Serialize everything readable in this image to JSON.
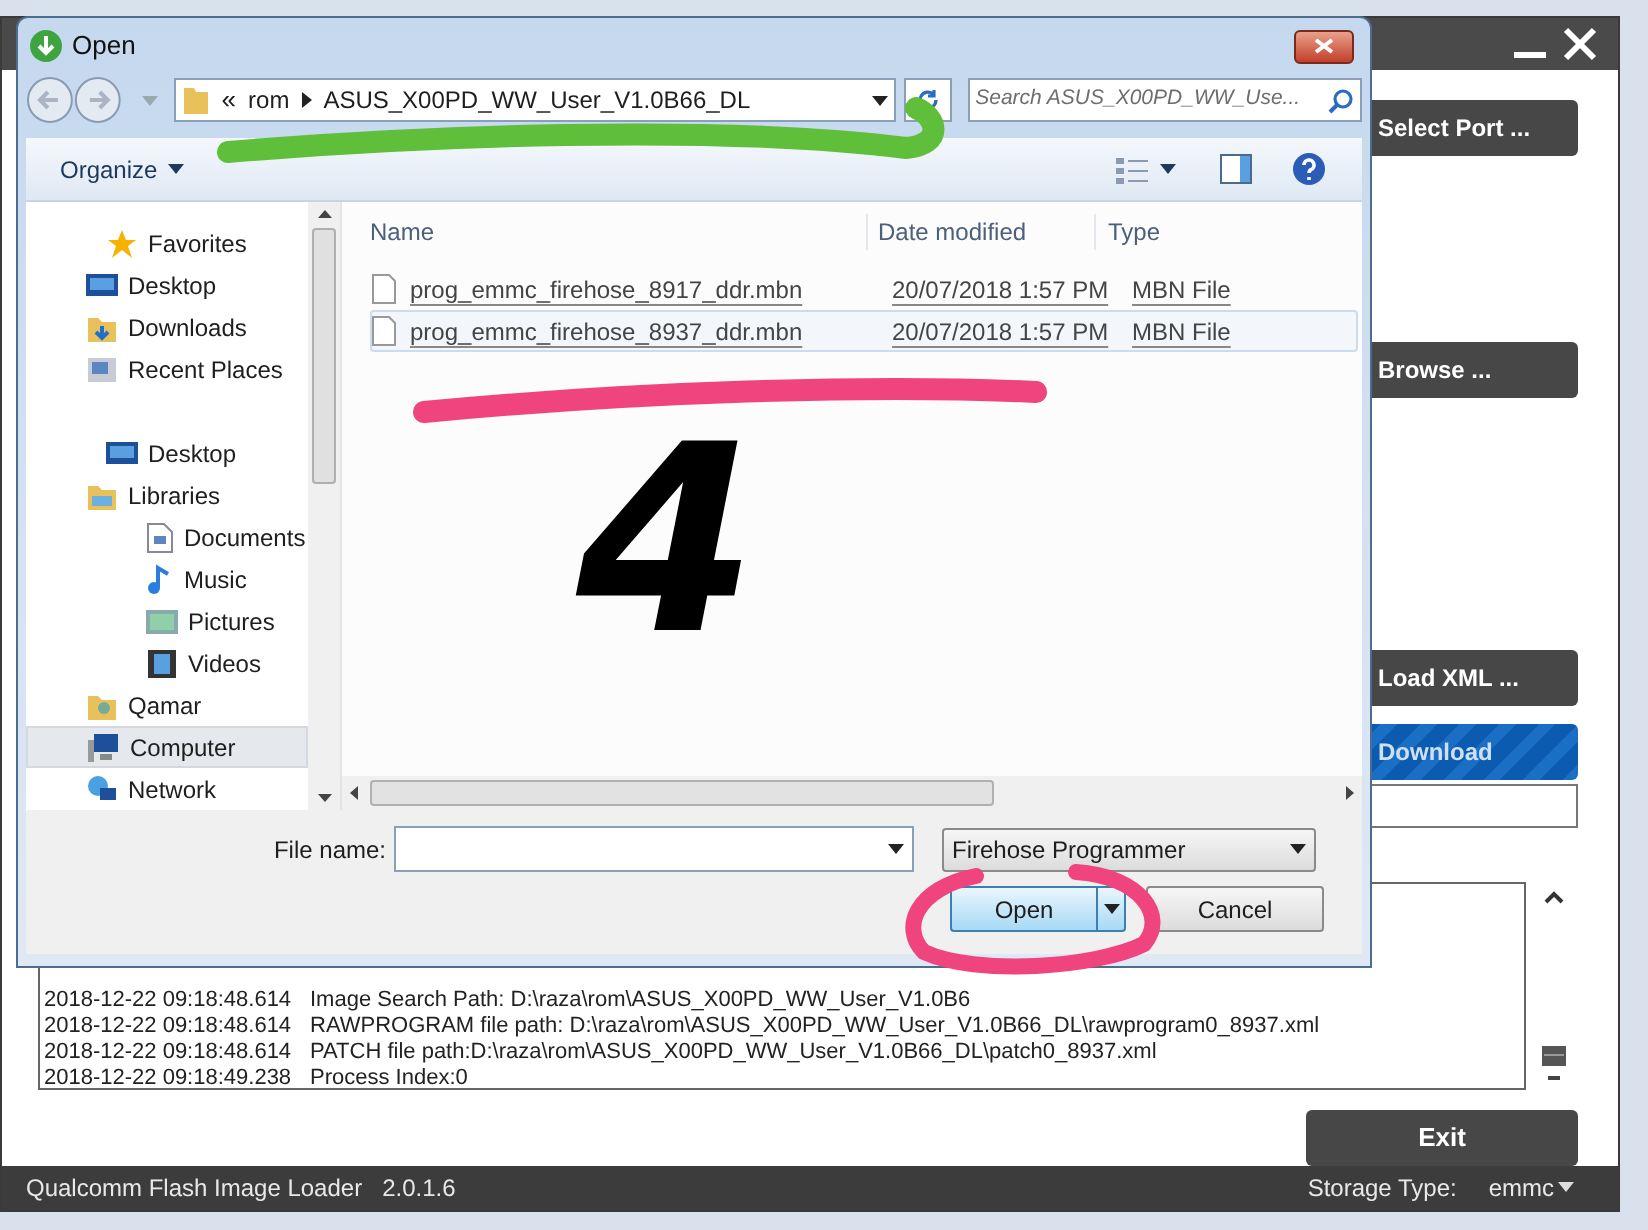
{
  "app": {
    "buttons": [
      {
        "label": "Select Port ...",
        "kind": "dark"
      },
      {
        "label": "Browse ...",
        "kind": "dark"
      },
      {
        "label": "Load XML ...",
        "kind": "dark"
      },
      {
        "label": "Download",
        "kind": "striped"
      }
    ],
    "log": [
      {
        "time": "2018-12-22 09:18:48.614",
        "message": "Image Search Path: D:\\raza\\rom\\ASUS_X00PD_WW_User_V1.0B6"
      },
      {
        "time": "2018-12-22 09:18:48.614",
        "message": "RAWPROGRAM file path: D:\\raza\\rom\\ASUS_X00PD_WW_User_V1.0B66_DL\\rawprogram0_8937.xml"
      },
      {
        "time": "2018-12-22 09:18:48.614",
        "message": "PATCH file path:D:\\raza\\rom\\ASUS_X00PD_WW_User_V1.0B66_DL\\patch0_8937.xml"
      },
      {
        "time": "2018-12-22 09:18:49.238",
        "message": "Process Index:0"
      }
    ],
    "exit_button": "Exit",
    "status_bar": {
      "product": "Qualcomm Flash Image Loader",
      "version": "2.0.1.6",
      "storage_label": "Storage Type:",
      "storage_value": "emmc"
    }
  },
  "dialog": {
    "title": "Open",
    "breadcrumb": {
      "overflow": "«",
      "segments": [
        "rom",
        "ASUS_X00PD_WW_User_V1.0B66_DL"
      ]
    },
    "search": {
      "placeholder": "Search ASUS_X00PD_WW_Use..."
    },
    "organize": "Organize",
    "nav": [
      {
        "label": "Favorites",
        "selected": false,
        "children": [
          {
            "label": "Desktop",
            "selected": false
          },
          {
            "label": "Downloads",
            "selected": false
          },
          {
            "label": "Recent Places",
            "selected": false
          }
        ]
      },
      {
        "label": "Desktop",
        "selected": false,
        "children": [
          {
            "label": "Libraries",
            "selected": false,
            "children": [
              {
                "label": "Documents",
                "selected": false
              },
              {
                "label": "Music",
                "selected": false
              },
              {
                "label": "Pictures",
                "selected": false
              },
              {
                "label": "Videos",
                "selected": false
              }
            ]
          },
          {
            "label": "Qamar",
            "selected": false
          },
          {
            "label": "Computer",
            "selected": true
          },
          {
            "label": "Network",
            "selected": false
          }
        ]
      }
    ],
    "columns": [
      "Name",
      "Date modified",
      "Type"
    ],
    "files": [
      {
        "name": "prog_emmc_firehose_8917_ddr.mbn",
        "date": "20/07/2018 1:57 PM",
        "type": "MBN File",
        "selected": false
      },
      {
        "name": "prog_emmc_firehose_8937_ddr.mbn",
        "date": "20/07/2018 1:57 PM",
        "type": "MBN File",
        "selected": true
      }
    ],
    "file_name_label": "File name:",
    "filter": "Firehose Programmer",
    "open_button": "Open",
    "cancel_button": "Cancel"
  },
  "annotation_text": "4"
}
